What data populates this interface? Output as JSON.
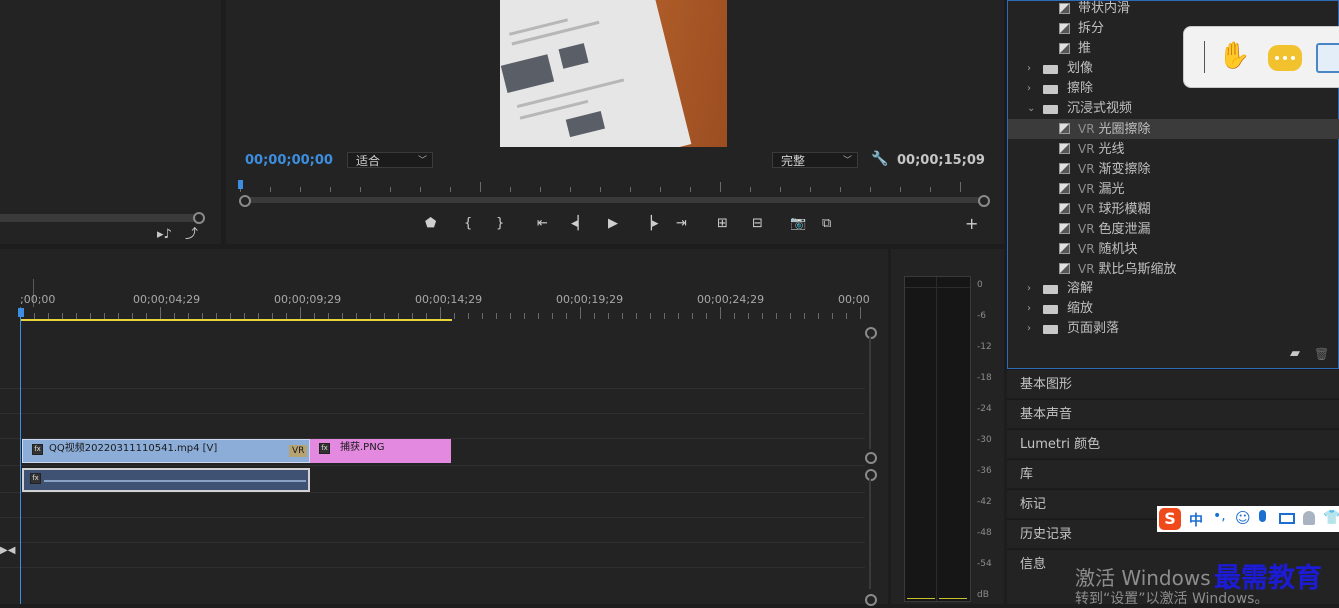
{
  "program_monitor": {
    "timecode_current": "00;00;00;00",
    "fit_dropdown": "适合",
    "quality_dropdown": "完整",
    "timecode_duration": "00;00;15;09"
  },
  "timeline": {
    "ruler_labels": [
      ";00;00",
      "00;00;04;29",
      "00;00;09;29",
      "00;00;14;29",
      "00;00;19;29",
      "00;00;24;29",
      "00;00"
    ],
    "clips": {
      "video_clip_name": "QQ视频20220311110541.mp4 [V]",
      "video_clip_badge": "VR",
      "image_clip_name": "捕获.PNG"
    }
  },
  "audio_meter": {
    "scale": [
      "0",
      "-6",
      "-12",
      "-18",
      "-24",
      "-30",
      "-36",
      "-42",
      "-48",
      "-54",
      "dB"
    ]
  },
  "effects_panel": {
    "vr_prefix": "VR",
    "items": [
      {
        "label": "带状内滑"
      },
      {
        "label": "拆分"
      },
      {
        "label": "推"
      },
      {
        "label": "划像"
      },
      {
        "label": "擦除"
      },
      {
        "label": "沉浸式视频"
      },
      {
        "label": "光圈擦除"
      },
      {
        "label": "光线"
      },
      {
        "label": "渐变擦除"
      },
      {
        "label": "漏光"
      },
      {
        "label": "球形模糊"
      },
      {
        "label": "色度泄漏"
      },
      {
        "label": "随机块"
      },
      {
        "label": "默比乌斯缩放"
      },
      {
        "label": "溶解"
      },
      {
        "label": "缩放"
      },
      {
        "label": "页面剥落"
      }
    ]
  },
  "panels": {
    "essential_graphics": "基本图形",
    "essential_sound": "基本声音",
    "lumetri_color": "Lumetri 颜色",
    "libraries": "库",
    "markers": "标记",
    "history": "历史记录",
    "info": "信息"
  },
  "ime_toolbar": {
    "mode": "中"
  },
  "watermark": {
    "activate_title": "激活 Windows",
    "activate_sub": "转到“设置”以激活 Windows。",
    "brand": "最需教育"
  },
  "colors": {
    "accent_blue": "#3d8ee0",
    "video_clip": "#8cadd8",
    "image_clip": "#e38ae0",
    "work_area": "#e8d33a"
  }
}
